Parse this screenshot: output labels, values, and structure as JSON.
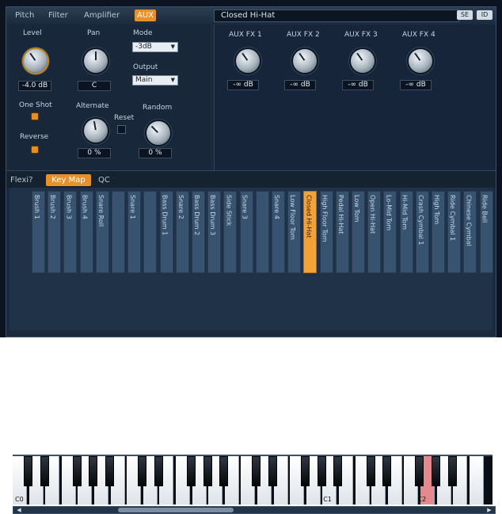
{
  "tabs": [
    "Pitch",
    "Filter",
    "Amplifier",
    "AUX"
  ],
  "preset_name": "Closed Hi-Hat",
  "header_buttons": [
    "SE",
    "ID"
  ],
  "left_labels": {
    "level": "Level",
    "pan": "Pan",
    "mode": "Mode",
    "output": "Output",
    "one_shot": "One Shot",
    "reverse": "Reverse",
    "alternate": "Alternate",
    "reset": "Reset",
    "random": "Random"
  },
  "values": {
    "level": "-4.0 dB",
    "pan": "C",
    "mode": "-3dB",
    "output": "Main",
    "alternate": "0 %",
    "random": "0 %"
  },
  "aux_fx": [
    {
      "label": "AUX FX 1",
      "value": "-∞ dB"
    },
    {
      "label": "AUX FX 2",
      "value": "-∞ dB"
    },
    {
      "label": "AUX FX 3",
      "value": "-∞ dB"
    },
    {
      "label": "AUX FX 4",
      "value": "-∞ dB"
    }
  ],
  "sub_tabs": [
    "Flexi?",
    "Key Map",
    "QC"
  ],
  "lanes": [
    "Brush 1",
    "Brush 2",
    "Brush 3",
    "Brush 4",
    "Snare Roll",
    "",
    "Snare 1",
    "",
    "Bass Drum 1",
    "Snare 2",
    "Bass Drum 2",
    "Bass Drum 3",
    "Side Stick",
    "Snare 3",
    "",
    "Snare 4",
    "Low Floor Tom",
    "Closed Hi-Hat",
    "High Floor Tom",
    "Pedal Hi-Hat",
    "Low Tom",
    "Open Hi-Hat",
    "Lo-Mid Tom",
    "Hi-Mid Tom",
    "Crash Cymbal 1",
    "High Tom",
    "Ride Cymbal 1",
    "Chinese Cymbal",
    "Ride Bell"
  ],
  "key_labels": {
    "c0": "C0",
    "c1": "C1",
    "c2": "C2"
  },
  "colors": {
    "accent": "#e8912a",
    "active_lane": "#f3a23a",
    "pressed_key": "#e5898f"
  }
}
